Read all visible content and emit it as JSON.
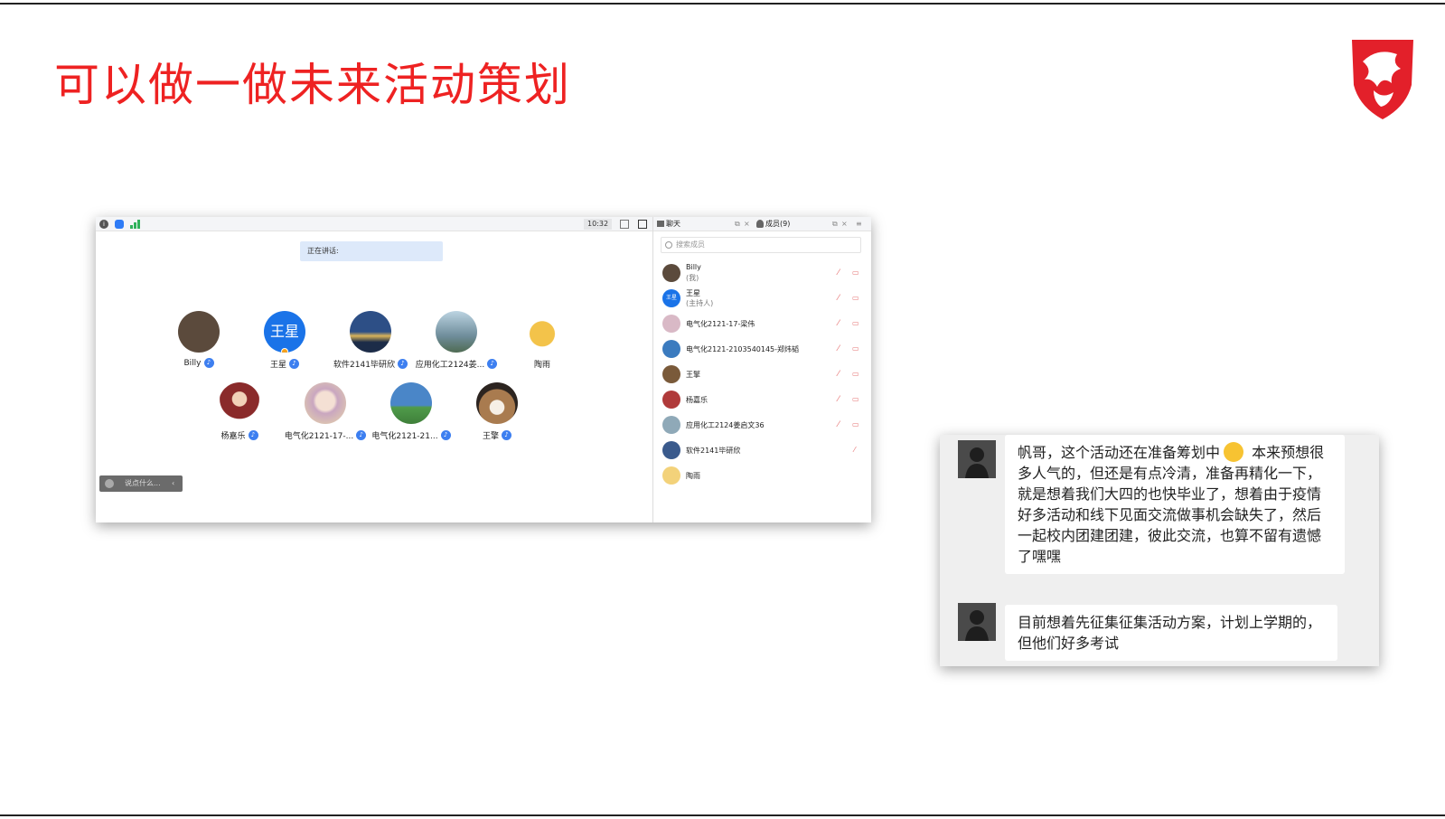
{
  "slide": {
    "title": "可以做一做未来活动策划"
  },
  "meeting": {
    "time": "10:32",
    "speaking_label": "正在讲话:",
    "chat_placeholder": "说点什么...",
    "grid_row1": [
      {
        "name": "Billy",
        "avatar_color": "#5b4a3c"
      },
      {
        "name": "王星",
        "avatar_text": "王星",
        "avatar_color": "#1a73e8"
      },
      {
        "name": "软件2141毕研欣",
        "avatar_color": "#3a5a8c"
      },
      {
        "name": "应用化工2124姜...",
        "avatar_color": "#8fa9b8"
      },
      {
        "name": "陶雨",
        "avatar_color": "#f3d27a"
      }
    ],
    "grid_row2": [
      {
        "name": "杨嘉乐",
        "avatar_color": "#b03a3a"
      },
      {
        "name": "电气化2121-17-...",
        "avatar_color": "#d9b9c6"
      },
      {
        "name": "电气化2121-21...",
        "avatar_color": "#3b7bbf"
      },
      {
        "name": "王擎",
        "avatar_color": "#7a5a3a"
      }
    ]
  },
  "panel": {
    "tab_chat": "聊天",
    "tab_members": "成员(9)",
    "search_placeholder": "搜索成员",
    "members": [
      {
        "name": "Billy",
        "sub": "(我)",
        "avatar_color": "#5b4a3c"
      },
      {
        "name": "王星",
        "sub": "(主持人)",
        "avatar_text": "王星",
        "avatar_color": "#1a73e8"
      },
      {
        "name": "电气化2121-17-梁伟",
        "sub": "",
        "avatar_color": "#d9b9c6"
      },
      {
        "name": "电气化2121-2103540145-郑炜韬",
        "sub": "",
        "avatar_color": "#3b7bbf"
      },
      {
        "name": "王擎",
        "sub": "",
        "avatar_color": "#7a5a3a"
      },
      {
        "name": "杨嘉乐",
        "sub": "",
        "avatar_color": "#b03a3a"
      },
      {
        "name": "应用化工2124姜启文36",
        "sub": "",
        "avatar_color": "#8fa9b8"
      },
      {
        "name": "软件2141毕研欣",
        "sub": "",
        "avatar_color": "#3a5a8c"
      },
      {
        "name": "陶雨",
        "sub": "",
        "avatar_color": "#f3d27a"
      }
    ]
  },
  "chat": {
    "msg1_before_emoji": "帆哥，这个活动还在准备筹划中",
    "msg1_after_emoji": " 本来预想很多人气的，但还是有点冷清，准备再精化一下，就是想着我们大四的也快毕业了，想着由于疫情好多活动和线下见面交流做事机会缺失了，然后一起校内团建团建，彼此交流，也算不留有遗憾了嘿嘿",
    "msg2": "目前想着先征集征集活动方案，计划上学期的，但他们好多考试"
  }
}
